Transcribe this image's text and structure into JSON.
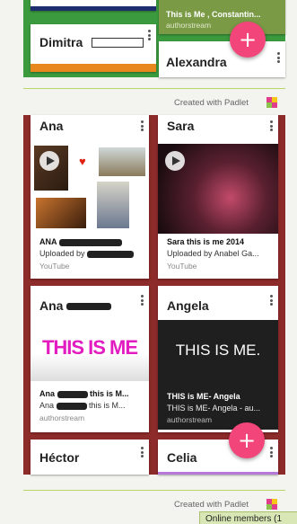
{
  "top_section": {
    "card_dimitra": {
      "name": "Dimitra"
    },
    "card_top_right": {
      "title": "This is Me , Constantin...",
      "source": "authorstream"
    },
    "card_alexandra": {
      "name": "Alexandra"
    },
    "fab_icon": "+"
  },
  "footer1": {
    "created_with": "Created with Padlet"
  },
  "cards": {
    "ana1": {
      "name": "Ana",
      "line1": "ANA",
      "line2": "Uploaded by",
      "source": "YouTube",
      "icon": "play-icon"
    },
    "sara": {
      "name": "Sara",
      "line1": "Sara this is me 2014",
      "line2": "Uploaded by Anabel Ga...",
      "source": "YouTube",
      "icon": "play-icon"
    },
    "ana2": {
      "name": "Ana",
      "thumb_text": "THIS IS ME",
      "line1": "this is M...",
      "line2": "this is M...",
      "prefix1": "Ana",
      "prefix2": "Ana",
      "source": "authorstream"
    },
    "angela": {
      "name": "Angela",
      "thumb_text": "THIS IS ME.",
      "line1": "THIS is ME- Angela",
      "line2": "THIS is ME- Angela - au...",
      "source": "authorstream"
    },
    "hector": {
      "name": "Héctor"
    },
    "celia": {
      "name": "Celia"
    }
  },
  "fab2_icon": "+",
  "footer2": {
    "created_with": "Created with Padlet"
  },
  "online_members": "Online members (1"
}
